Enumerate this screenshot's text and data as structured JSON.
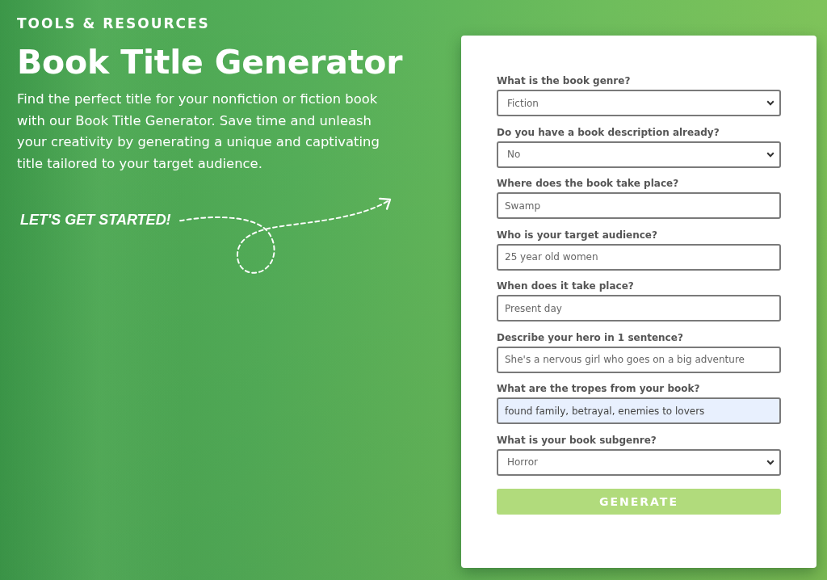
{
  "header": {
    "eyebrow": "TOOLS & RESOURCES",
    "title": "Book Title Generator",
    "description": "Find the perfect title for your nonfiction or fiction book with our Book Title Generator. Save time and unleash your creativity by generating a unique and captivating title tailored to your target audience."
  },
  "call_to_action": {
    "text": "LET'S GET STARTED!"
  },
  "form": {
    "fields": [
      {
        "kind": "select",
        "label": "What is the book genre?",
        "value": "Fiction",
        "autofilled": false
      },
      {
        "kind": "select",
        "label": "Do you have a book description already?",
        "value": "No",
        "autofilled": false
      },
      {
        "kind": "text",
        "label": "Where does the book take place?",
        "value": "Swamp",
        "autofilled": false
      },
      {
        "kind": "text",
        "label": "Who is your target audience?",
        "value": "25 year old women",
        "autofilled": false
      },
      {
        "kind": "text",
        "label": "When does it take place?",
        "value": "Present day",
        "autofilled": false
      },
      {
        "kind": "text",
        "label": "Describe your hero in 1 sentence?",
        "value": "She's a nervous girl who goes on a big adventure",
        "autofilled": false
      },
      {
        "kind": "text",
        "label": "What are the tropes from your book?",
        "value": "found family, betrayal, enemies to lovers",
        "autofilled": true
      },
      {
        "kind": "select",
        "label": "What is your book subgenre?",
        "value": "Horror",
        "autofilled": false
      }
    ],
    "button": "GENERATE"
  }
}
